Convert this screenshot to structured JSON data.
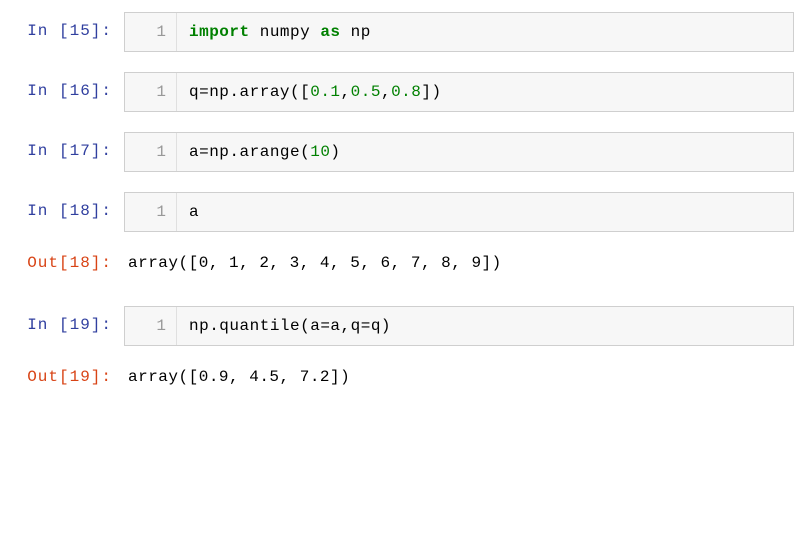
{
  "cells": [
    {
      "type": "input",
      "prompt": "In  [15]:",
      "lineNumber": "1",
      "tokens": [
        {
          "cls": "kw-import",
          "t": "import"
        },
        {
          "cls": "c-text",
          "t": " numpy "
        },
        {
          "cls": "kw-as",
          "t": "as"
        },
        {
          "cls": "c-text",
          "t": " np"
        }
      ]
    },
    {
      "type": "input",
      "prompt": "In  [16]:",
      "lineNumber": "1",
      "tokens": [
        {
          "cls": "c-text",
          "t": "q=np.array(["
        },
        {
          "cls": "c-num",
          "t": "0.1"
        },
        {
          "cls": "c-text",
          "t": ","
        },
        {
          "cls": "c-num",
          "t": "0.5"
        },
        {
          "cls": "c-text",
          "t": ","
        },
        {
          "cls": "c-num",
          "t": "0.8"
        },
        {
          "cls": "c-text",
          "t": "])"
        }
      ]
    },
    {
      "type": "input",
      "prompt": "In  [17]:",
      "lineNumber": "1",
      "tokens": [
        {
          "cls": "c-text",
          "t": "a=np.arange("
        },
        {
          "cls": "c-num",
          "t": "10"
        },
        {
          "cls": "c-text",
          "t": ")"
        }
      ]
    },
    {
      "type": "input",
      "prompt": "In  [18]:",
      "lineNumber": "1",
      "tokens": [
        {
          "cls": "c-text",
          "t": "a"
        }
      ]
    },
    {
      "type": "output",
      "prompt": "Out[18]:",
      "text": "array([0, 1, 2, 3, 4, 5, 6, 7, 8, 9])"
    },
    {
      "type": "input",
      "prompt": "In  [19]:",
      "lineNumber": "1",
      "tokens": [
        {
          "cls": "c-text",
          "t": "np.quantile(a=a,q=q)"
        }
      ]
    },
    {
      "type": "output",
      "prompt": "Out[19]:",
      "text": "array([0.9, 4.5, 7.2])"
    }
  ]
}
